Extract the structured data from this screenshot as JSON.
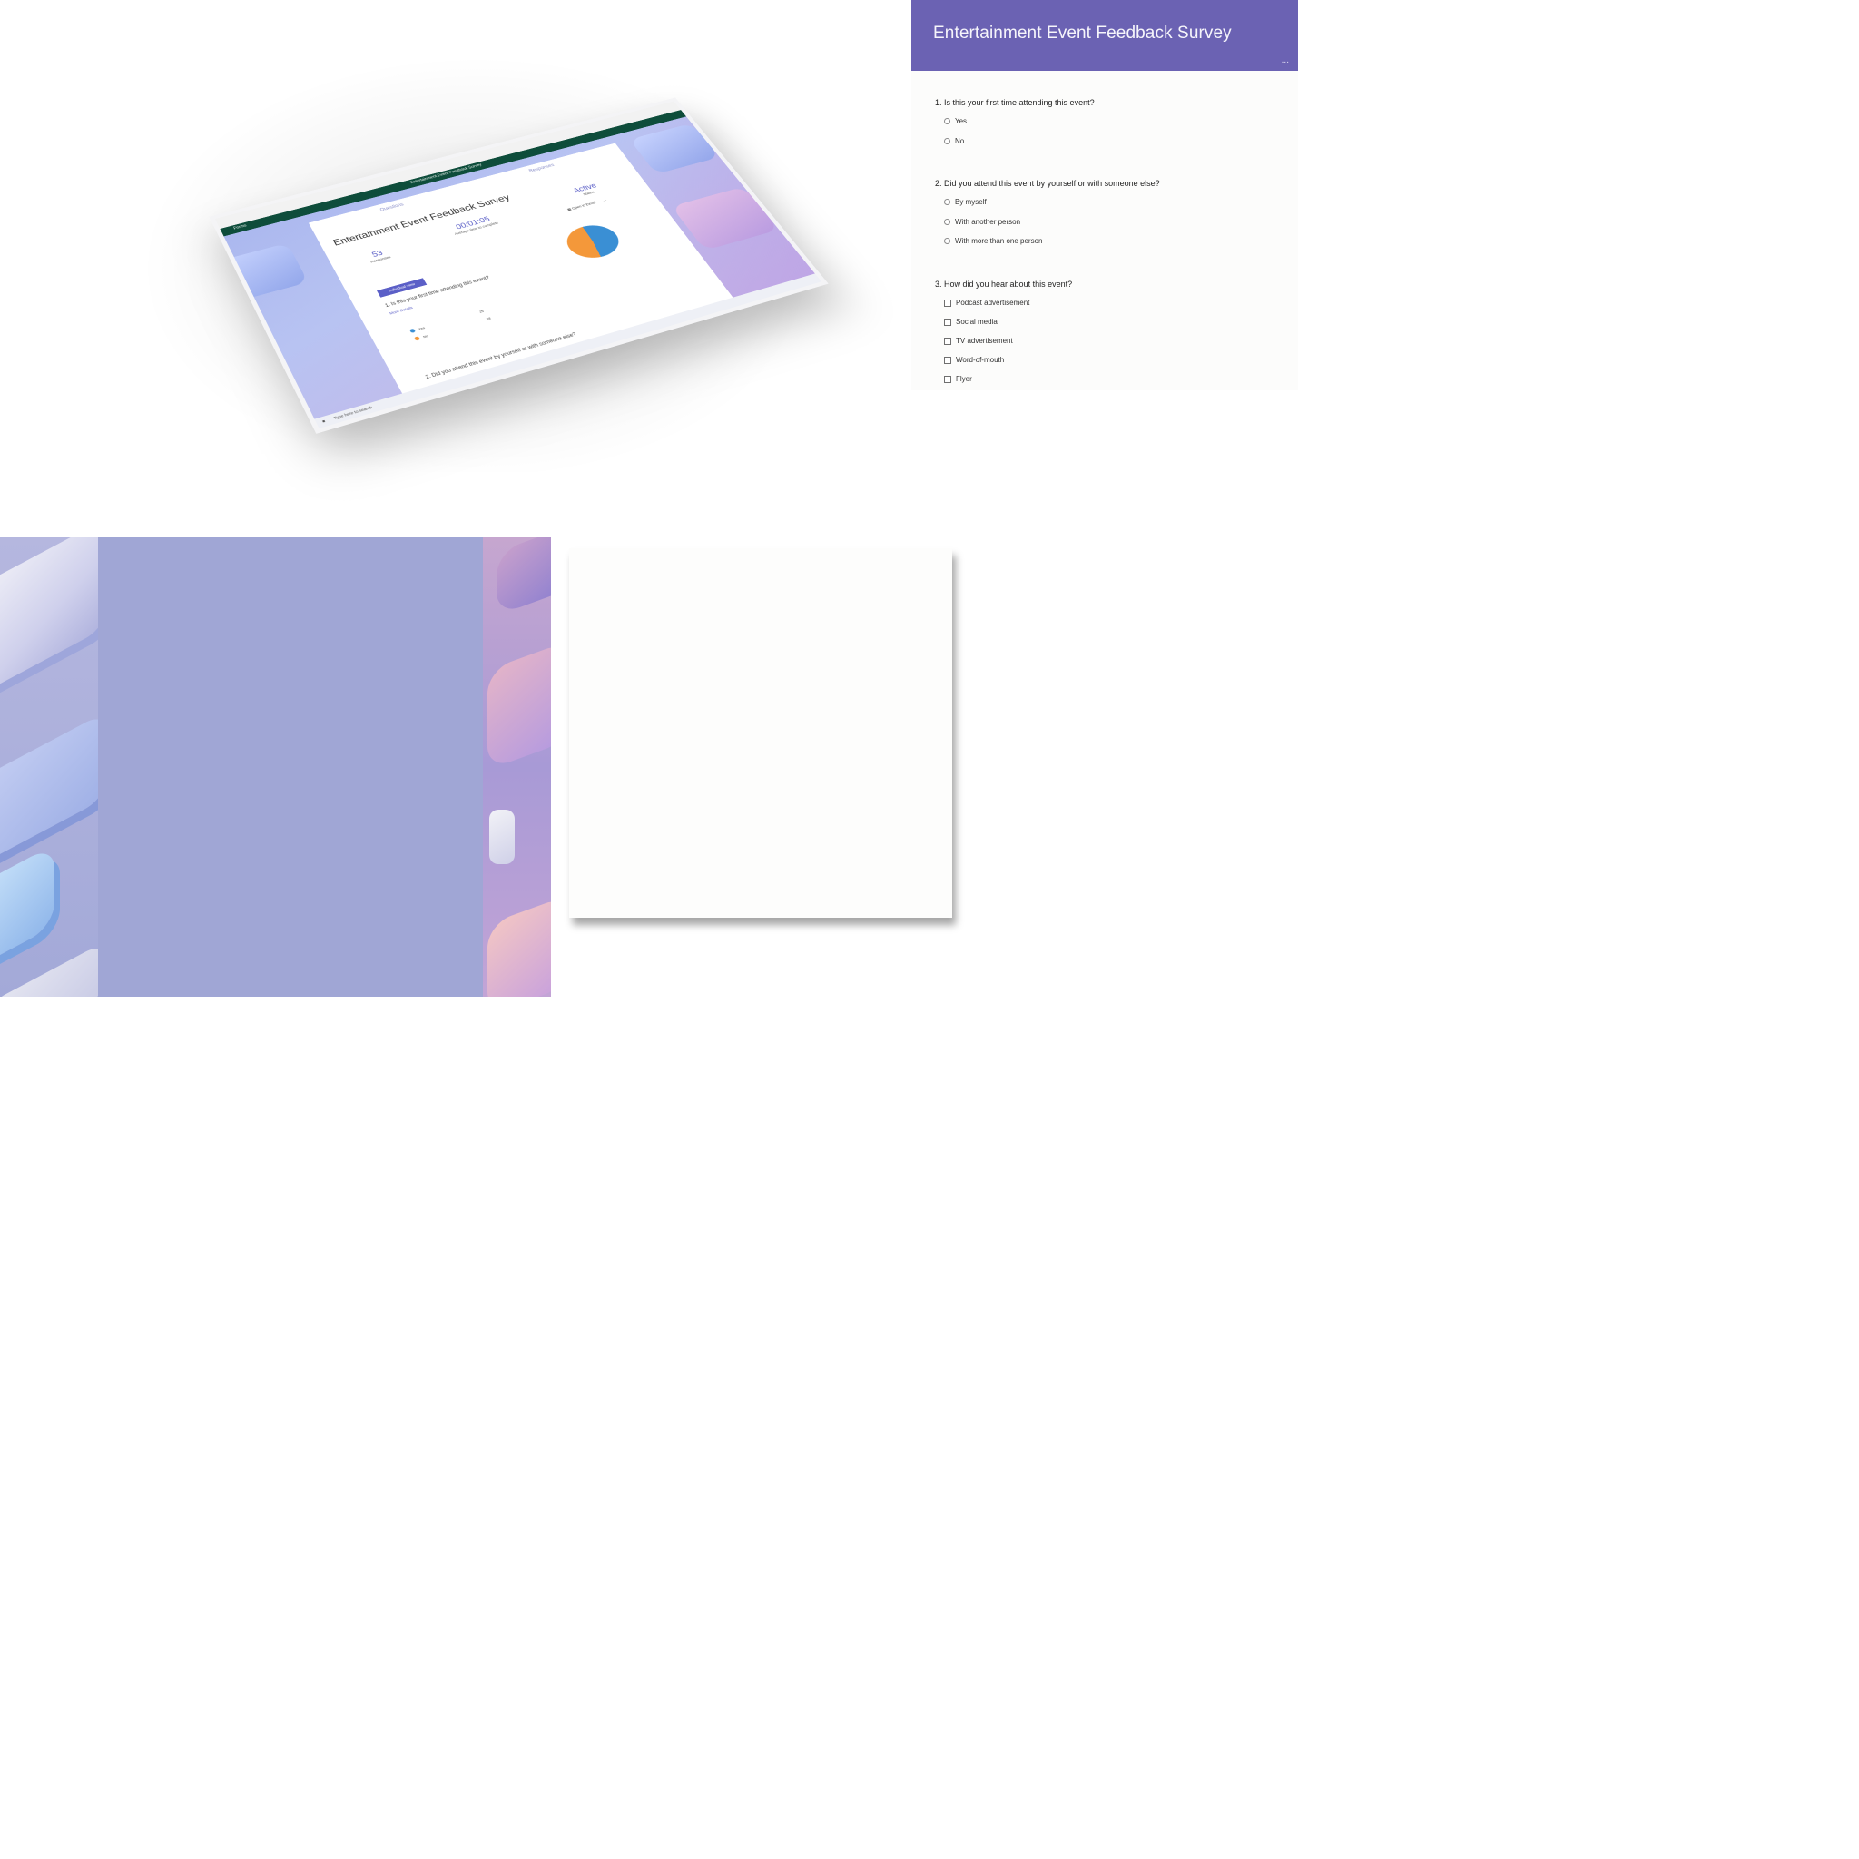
{
  "mockup": {
    "app_name": "Forms",
    "window_title": "Entertainment Event Feedback Survey",
    "tabs": [
      "Questions",
      "Responses"
    ],
    "survey_title": "Entertainment Event Feedback Survey",
    "stats": [
      {
        "value": "53",
        "label": "Responses"
      },
      {
        "value": "00:01:05",
        "label": "Average time to complete"
      },
      {
        "value": "Active",
        "label": "Status"
      }
    ],
    "open_in_excel": "Open in Excel",
    "more": "...",
    "view_button": "Individual view",
    "question1": "1. Is this your first time attending this event?",
    "more_details": "More Details",
    "legend": [
      {
        "label": "Yes",
        "value": "25",
        "color": "#3a8fd4"
      },
      {
        "label": "No",
        "value": "28",
        "color": "#f4983a"
      }
    ],
    "question2": "2. Did you attend this event by yourself or with someone else?",
    "taskbar_search": "Type here to search"
  },
  "survey": {
    "title": "Entertainment Event Feedback Survey",
    "more": "...",
    "header_color": "#6b62b3",
    "questions": [
      {
        "text": "1. Is this your first time attending this event?",
        "type": "radio",
        "options": [
          "Yes",
          "No"
        ]
      },
      {
        "text": "2. Did you attend this event by yourself or with someone else?",
        "type": "radio",
        "options": [
          "By myself",
          "With another person",
          "With more than one person"
        ]
      },
      {
        "text": "3. How did you hear about this event?",
        "type": "checkbox",
        "options": [
          "Podcast advertisement",
          "Social media",
          "TV advertisement",
          "Word-of-mouth",
          "Flyer"
        ]
      }
    ]
  }
}
